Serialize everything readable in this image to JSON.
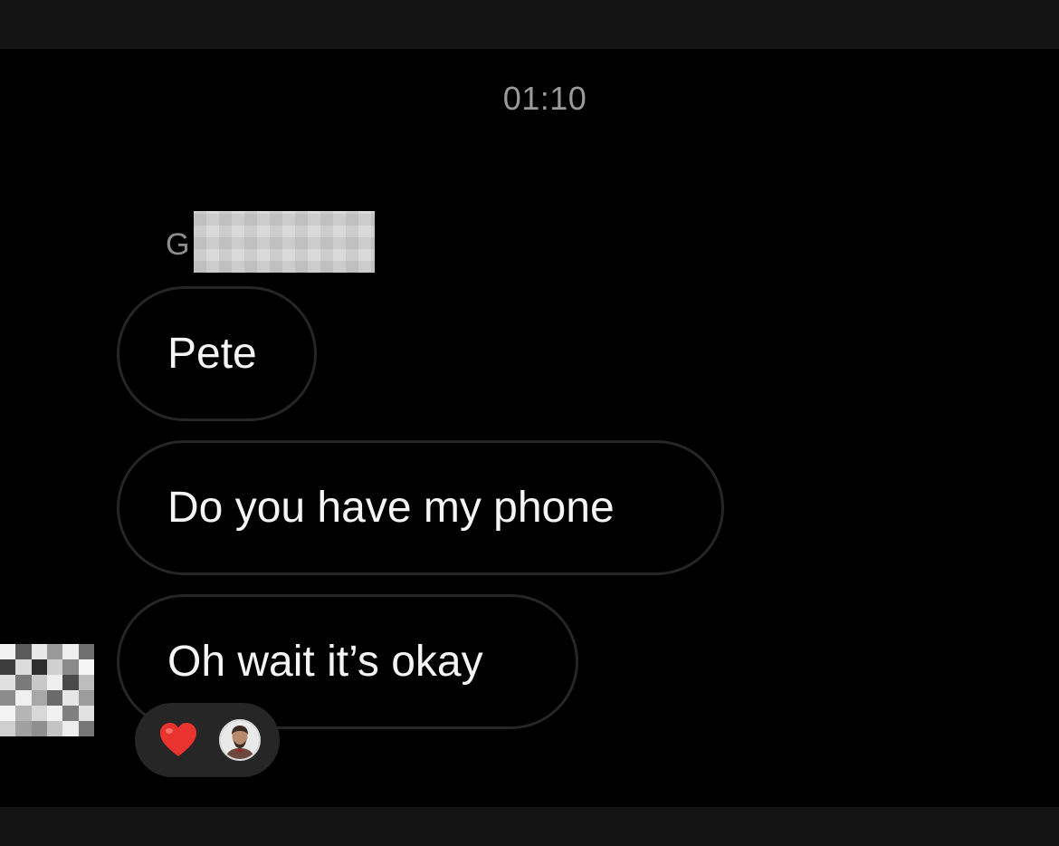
{
  "conversation": {
    "timestamp": "01:10",
    "sender_initial": "G",
    "messages": [
      {
        "text": "Pete"
      },
      {
        "text": "Do you have my phone"
      },
      {
        "text": "Oh wait it’s okay"
      }
    ],
    "reaction": {
      "emoji_icon": "heart-icon",
      "emoji_color": "#e8332f"
    }
  },
  "theme": {
    "background": "#000000",
    "bar_color": "#141414",
    "bubble_border": "#262626",
    "text_color": "#f5f5f5",
    "muted_text": "#9a9a9a"
  }
}
